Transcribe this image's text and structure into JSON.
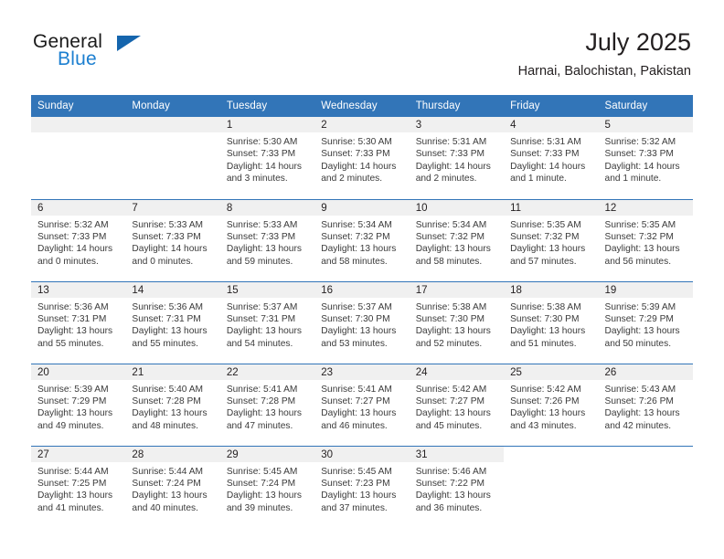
{
  "brand": {
    "name_part1": "General",
    "name_part2": "Blue",
    "triangle_color": "#1565ad",
    "blue_text_color": "#1c7fd0"
  },
  "header": {
    "title": "July 2025",
    "subtitle": "Harnai, Balochistan, Pakistan"
  },
  "theme": {
    "header_bg": "#3275b8",
    "header_text": "#ffffff",
    "daynum_bg": "#f0f0f0",
    "grid_line": "#3275b8"
  },
  "weekdays": [
    "Sunday",
    "Monday",
    "Tuesday",
    "Wednesday",
    "Thursday",
    "Friday",
    "Saturday"
  ],
  "weeks": [
    [
      {
        "day": "",
        "sunrise": "",
        "sunset": "",
        "daylight1": "",
        "daylight2": ""
      },
      {
        "day": "",
        "sunrise": "",
        "sunset": "",
        "daylight1": "",
        "daylight2": ""
      },
      {
        "day": "1",
        "sunrise": "Sunrise: 5:30 AM",
        "sunset": "Sunset: 7:33 PM",
        "daylight1": "Daylight: 14 hours",
        "daylight2": "and 3 minutes."
      },
      {
        "day": "2",
        "sunrise": "Sunrise: 5:30 AM",
        "sunset": "Sunset: 7:33 PM",
        "daylight1": "Daylight: 14 hours",
        "daylight2": "and 2 minutes."
      },
      {
        "day": "3",
        "sunrise": "Sunrise: 5:31 AM",
        "sunset": "Sunset: 7:33 PM",
        "daylight1": "Daylight: 14 hours",
        "daylight2": "and 2 minutes."
      },
      {
        "day": "4",
        "sunrise": "Sunrise: 5:31 AM",
        "sunset": "Sunset: 7:33 PM",
        "daylight1": "Daylight: 14 hours",
        "daylight2": "and 1 minute."
      },
      {
        "day": "5",
        "sunrise": "Sunrise: 5:32 AM",
        "sunset": "Sunset: 7:33 PM",
        "daylight1": "Daylight: 14 hours",
        "daylight2": "and 1 minute."
      }
    ],
    [
      {
        "day": "6",
        "sunrise": "Sunrise: 5:32 AM",
        "sunset": "Sunset: 7:33 PM",
        "daylight1": "Daylight: 14 hours",
        "daylight2": "and 0 minutes."
      },
      {
        "day": "7",
        "sunrise": "Sunrise: 5:33 AM",
        "sunset": "Sunset: 7:33 PM",
        "daylight1": "Daylight: 14 hours",
        "daylight2": "and 0 minutes."
      },
      {
        "day": "8",
        "sunrise": "Sunrise: 5:33 AM",
        "sunset": "Sunset: 7:33 PM",
        "daylight1": "Daylight: 13 hours",
        "daylight2": "and 59 minutes."
      },
      {
        "day": "9",
        "sunrise": "Sunrise: 5:34 AM",
        "sunset": "Sunset: 7:32 PM",
        "daylight1": "Daylight: 13 hours",
        "daylight2": "and 58 minutes."
      },
      {
        "day": "10",
        "sunrise": "Sunrise: 5:34 AM",
        "sunset": "Sunset: 7:32 PM",
        "daylight1": "Daylight: 13 hours",
        "daylight2": "and 58 minutes."
      },
      {
        "day": "11",
        "sunrise": "Sunrise: 5:35 AM",
        "sunset": "Sunset: 7:32 PM",
        "daylight1": "Daylight: 13 hours",
        "daylight2": "and 57 minutes."
      },
      {
        "day": "12",
        "sunrise": "Sunrise: 5:35 AM",
        "sunset": "Sunset: 7:32 PM",
        "daylight1": "Daylight: 13 hours",
        "daylight2": "and 56 minutes."
      }
    ],
    [
      {
        "day": "13",
        "sunrise": "Sunrise: 5:36 AM",
        "sunset": "Sunset: 7:31 PM",
        "daylight1": "Daylight: 13 hours",
        "daylight2": "and 55 minutes."
      },
      {
        "day": "14",
        "sunrise": "Sunrise: 5:36 AM",
        "sunset": "Sunset: 7:31 PM",
        "daylight1": "Daylight: 13 hours",
        "daylight2": "and 55 minutes."
      },
      {
        "day": "15",
        "sunrise": "Sunrise: 5:37 AM",
        "sunset": "Sunset: 7:31 PM",
        "daylight1": "Daylight: 13 hours",
        "daylight2": "and 54 minutes."
      },
      {
        "day": "16",
        "sunrise": "Sunrise: 5:37 AM",
        "sunset": "Sunset: 7:30 PM",
        "daylight1": "Daylight: 13 hours",
        "daylight2": "and 53 minutes."
      },
      {
        "day": "17",
        "sunrise": "Sunrise: 5:38 AM",
        "sunset": "Sunset: 7:30 PM",
        "daylight1": "Daylight: 13 hours",
        "daylight2": "and 52 minutes."
      },
      {
        "day": "18",
        "sunrise": "Sunrise: 5:38 AM",
        "sunset": "Sunset: 7:30 PM",
        "daylight1": "Daylight: 13 hours",
        "daylight2": "and 51 minutes."
      },
      {
        "day": "19",
        "sunrise": "Sunrise: 5:39 AM",
        "sunset": "Sunset: 7:29 PM",
        "daylight1": "Daylight: 13 hours",
        "daylight2": "and 50 minutes."
      }
    ],
    [
      {
        "day": "20",
        "sunrise": "Sunrise: 5:39 AM",
        "sunset": "Sunset: 7:29 PM",
        "daylight1": "Daylight: 13 hours",
        "daylight2": "and 49 minutes."
      },
      {
        "day": "21",
        "sunrise": "Sunrise: 5:40 AM",
        "sunset": "Sunset: 7:28 PM",
        "daylight1": "Daylight: 13 hours",
        "daylight2": "and 48 minutes."
      },
      {
        "day": "22",
        "sunrise": "Sunrise: 5:41 AM",
        "sunset": "Sunset: 7:28 PM",
        "daylight1": "Daylight: 13 hours",
        "daylight2": "and 47 minutes."
      },
      {
        "day": "23",
        "sunrise": "Sunrise: 5:41 AM",
        "sunset": "Sunset: 7:27 PM",
        "daylight1": "Daylight: 13 hours",
        "daylight2": "and 46 minutes."
      },
      {
        "day": "24",
        "sunrise": "Sunrise: 5:42 AM",
        "sunset": "Sunset: 7:27 PM",
        "daylight1": "Daylight: 13 hours",
        "daylight2": "and 45 minutes."
      },
      {
        "day": "25",
        "sunrise": "Sunrise: 5:42 AM",
        "sunset": "Sunset: 7:26 PM",
        "daylight1": "Daylight: 13 hours",
        "daylight2": "and 43 minutes."
      },
      {
        "day": "26",
        "sunrise": "Sunrise: 5:43 AM",
        "sunset": "Sunset: 7:26 PM",
        "daylight1": "Daylight: 13 hours",
        "daylight2": "and 42 minutes."
      }
    ],
    [
      {
        "day": "27",
        "sunrise": "Sunrise: 5:44 AM",
        "sunset": "Sunset: 7:25 PM",
        "daylight1": "Daylight: 13 hours",
        "daylight2": "and 41 minutes."
      },
      {
        "day": "28",
        "sunrise": "Sunrise: 5:44 AM",
        "sunset": "Sunset: 7:24 PM",
        "daylight1": "Daylight: 13 hours",
        "daylight2": "and 40 minutes."
      },
      {
        "day": "29",
        "sunrise": "Sunrise: 5:45 AM",
        "sunset": "Sunset: 7:24 PM",
        "daylight1": "Daylight: 13 hours",
        "daylight2": "and 39 minutes."
      },
      {
        "day": "30",
        "sunrise": "Sunrise: 5:45 AM",
        "sunset": "Sunset: 7:23 PM",
        "daylight1": "Daylight: 13 hours",
        "daylight2": "and 37 minutes."
      },
      {
        "day": "31",
        "sunrise": "Sunrise: 5:46 AM",
        "sunset": "Sunset: 7:22 PM",
        "daylight1": "Daylight: 13 hours",
        "daylight2": "and 36 minutes."
      },
      {
        "day": "",
        "sunrise": "",
        "sunset": "",
        "daylight1": "",
        "daylight2": ""
      },
      {
        "day": "",
        "sunrise": "",
        "sunset": "",
        "daylight1": "",
        "daylight2": ""
      }
    ]
  ]
}
